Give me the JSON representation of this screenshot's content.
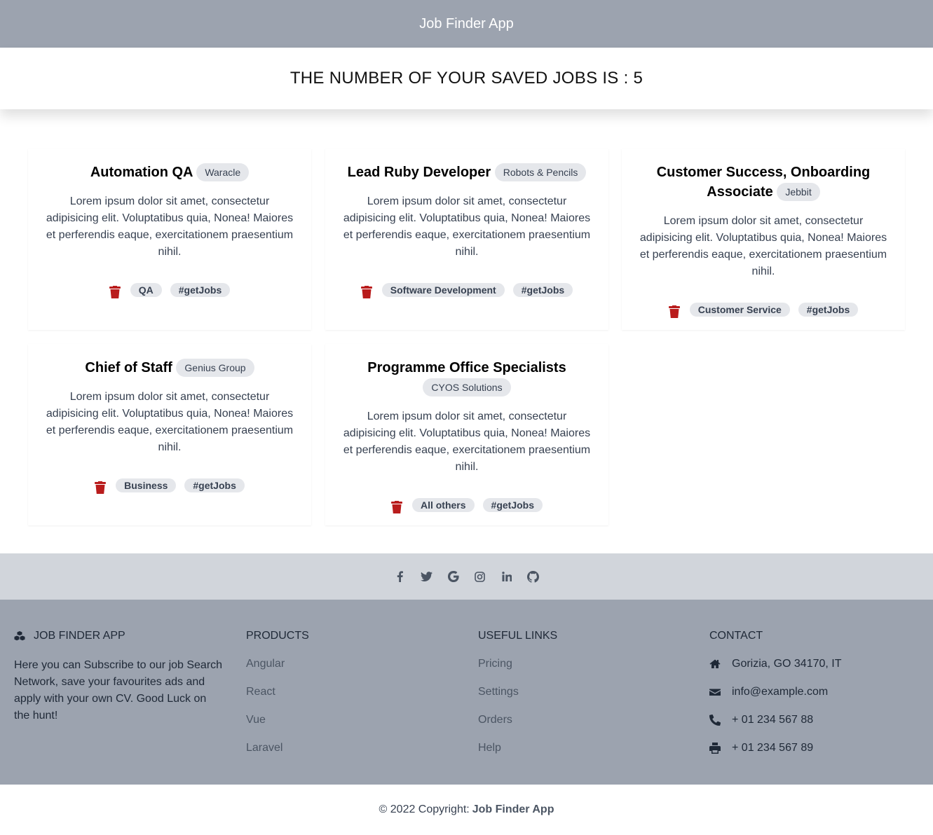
{
  "navbar": {
    "brand": "Job Finder App"
  },
  "hero": {
    "title": "THE NUMBER OF YOUR SAVED JOBS IS : 5"
  },
  "jobs": [
    {
      "title": "Automation QA",
      "company": "Waracle",
      "description": "Lorem ipsum dolor sit amet, consectetur adipisicing elit. Voluptatibus quia, Nonea! Maiores et perferendis eaque, exercitationem praesentium nihil.",
      "tags": [
        "QA",
        "#getJobs"
      ]
    },
    {
      "title": "Lead Ruby Developer",
      "company": "Robots & Pencils",
      "description": "Lorem ipsum dolor sit amet, consectetur adipisicing elit. Voluptatibus quia, Nonea! Maiores et perferendis eaque, exercitationem praesentium nihil.",
      "tags": [
        "Software Development",
        "#getJobs"
      ]
    },
    {
      "title_line1": "Customer Success, Onboarding",
      "title_line2": "Associate",
      "company": "Jebbit",
      "description": "Lorem ipsum dolor sit amet, consectetur adipisicing elit. Voluptatibus quia, Nonea! Maiores et perferendis eaque, exercitationem praesentium nihil.",
      "tags": [
        "Customer Service",
        "#getJobs"
      ]
    },
    {
      "title": "Chief of Staff",
      "company": "Genius Group",
      "description": "Lorem ipsum dolor sit amet, consectetur adipisicing elit. Voluptatibus quia, Nonea! Maiores et perferendis eaque, exercitationem praesentium nihil.",
      "tags": [
        "Business",
        "#getJobs"
      ]
    },
    {
      "title": "Programme Office Specialists",
      "company": "CYOS Solutions",
      "description": "Lorem ipsum dolor sit amet, consectetur adipisicing elit. Voluptatibus quia, Nonea! Maiores et perferendis eaque, exercitationem praesentium nihil.",
      "tags": [
        "All others",
        "#getJobs"
      ]
    }
  ],
  "social": [
    "facebook-icon",
    "twitter-icon",
    "google-icon",
    "instagram-icon",
    "linkedin-icon",
    "github-icon"
  ],
  "footer": {
    "about": {
      "heading": "JOB FINDER APP",
      "text": "Here you can Subscribe to our job Search Network, save your favourites ads and apply with your own CV. Good Luck on the hunt!"
    },
    "products": {
      "heading": "PRODUCTS",
      "links": [
        "Angular",
        "React",
        "Vue",
        "Laravel"
      ]
    },
    "useful": {
      "heading": "USEFUL LINKS",
      "links": [
        "Pricing",
        "Settings",
        "Orders",
        "Help"
      ]
    },
    "contact": {
      "heading": "CONTACT",
      "address": "Gorizia, GO 34170, IT",
      "email": "info@example.com",
      "phone": "+ 01 234 567 88",
      "fax": "+ 01 234 567 89"
    }
  },
  "copyright": {
    "text": "© 2022 Copyright:",
    "brand": "Job Finder App"
  },
  "colors": {
    "trash": "#b91c1c",
    "navbar": "#9ca3af",
    "social_bar": "#d1d5db"
  }
}
